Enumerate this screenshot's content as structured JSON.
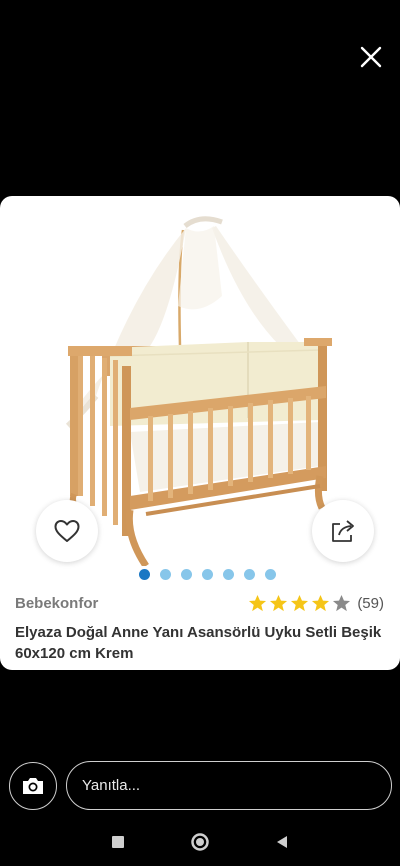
{
  "overlay": {
    "close_icon": "close-icon"
  },
  "product": {
    "brand": "Bebekonfor",
    "title": "Elyaza Doğal Anne Yanı Asansörlü Uyku Setli Beşik 60x120 cm Krem",
    "rating": {
      "stars": 4.5,
      "max": 5,
      "count_text": "(59)"
    },
    "image": {
      "pages": 7,
      "current_page": 1
    },
    "favorite_icon": "heart-icon",
    "share_icon": "share-icon",
    "colors": {
      "star": "#f5c518",
      "star_empty": "#8a8a8a",
      "dot_active": "#1b78c4",
      "dot": "#87c6ea"
    }
  },
  "reply": {
    "placeholder": "Yanıtla...",
    "camera_icon": "camera-icon"
  },
  "navigation": {
    "recents_icon": "square-icon",
    "home_icon": "circle-icon",
    "back_icon": "triangle-back-icon"
  }
}
